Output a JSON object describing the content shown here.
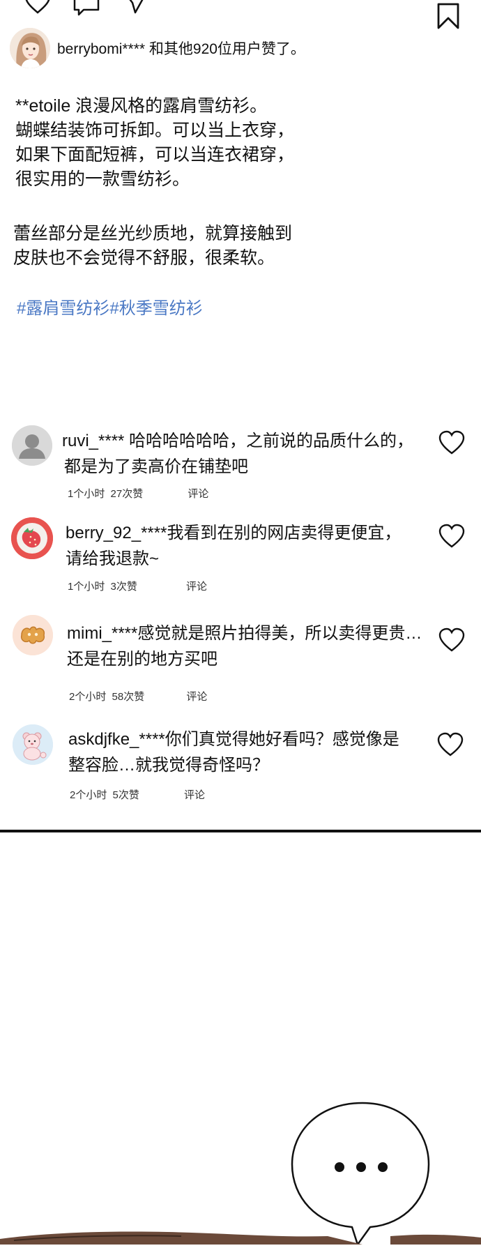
{
  "post": {
    "liked_by_user": "berrybomi****",
    "liked_by_suffix": " 和其他920位用户赞了。",
    "caption_lines": [
      "**etoile 浪漫风格的露肩雪纺衫。",
      "蝴蝶结装饰可拆卸。可以当上衣穿，",
      "如果下面配短裤，可以当连衣裙穿，",
      "很实用的一款雪纺衫。"
    ],
    "caption2_lines": [
      "蕾丝部分是丝光纱质地，就算接触到",
      "皮肤也不会觉得不舒服，很柔软。"
    ],
    "hashtags": "#露肩雪纺衫#秋季雪纺衫"
  },
  "comments": [
    {
      "user": "ruvi_****",
      "line1": " 哈哈哈哈哈哈，之前说的品质什么的，",
      "line2": "都是为了卖高价在铺垫吧",
      "time": "1个小时",
      "likes": "27次赞",
      "reply": "评论",
      "avatar": "default-user-icon"
    },
    {
      "user": "berry_92_****",
      "line1": "我看到在别的网店卖得更便宜，",
      "line2": "请给我退款~",
      "time": "1个小时",
      "likes": "3次赞",
      "reply": "评论",
      "avatar": "strawberry-icon"
    },
    {
      "user": "mimi_****",
      "line1": "感觉就是照片拍得美，所以卖得更贵…",
      "line2": "还是在别的地方买吧",
      "time": "2个小时",
      "likes": "58次赞",
      "reply": "评论",
      "avatar": "cookie-icon"
    },
    {
      "user": "askdjfke_****",
      "line1": "你们真觉得她好看吗？感觉像是",
      "line2": "整容脸…就我觉得奇怪吗？",
      "time": "2个小时",
      "likes": "5次赞",
      "reply": "评论",
      "avatar": "teddy-bear-icon"
    }
  ],
  "colors": {
    "hashtag": "#4a78c4",
    "divider": "#111111",
    "strawberry_bg": "#e8534f",
    "cookie_bg": "#fbe3d6",
    "bear_bg": "#dcecf7"
  }
}
